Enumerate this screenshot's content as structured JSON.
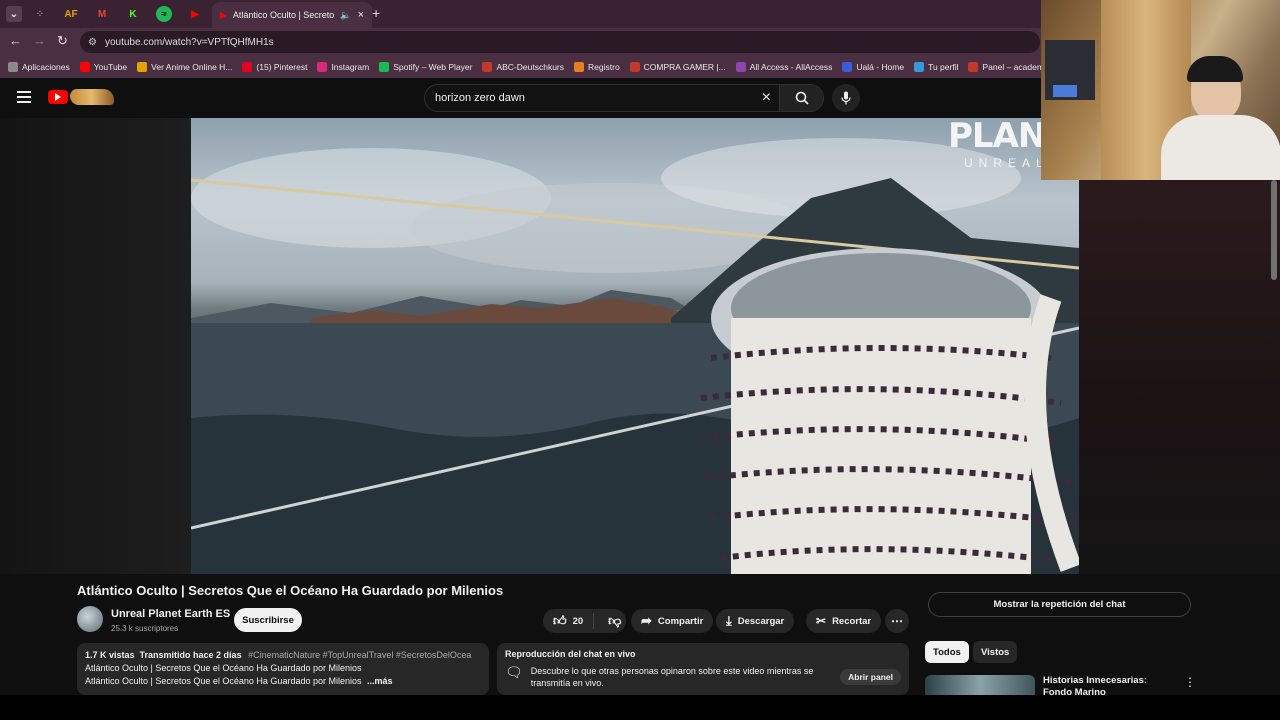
{
  "browser": {
    "active_tab_title": "Atlántico Oculto | Secretos",
    "new_tab": "+",
    "url": "youtube.com/watch?v=VPTfQHfMH1s"
  },
  "bookmarks": [
    {
      "label": "Aplicaciones",
      "color": "#8a8a8a"
    },
    {
      "label": "YouTube",
      "color": "#ff0000"
    },
    {
      "label": "Ver Anime Online H...",
      "color": "#e6a000"
    },
    {
      "label": "(15) Pinterest",
      "color": "#e60023"
    },
    {
      "label": "Instagram",
      "color": "#d62976"
    },
    {
      "label": "Spotify – Web Player",
      "color": "#1db954"
    },
    {
      "label": "ABC-Deutschkurs",
      "color": "#c0392b"
    },
    {
      "label": "Registro",
      "color": "#e67e22"
    },
    {
      "label": "COMPRA GAMER |...",
      "color": "#c0392b"
    },
    {
      "label": "All Access - AllAccess",
      "color": "#8e44ad"
    },
    {
      "label": "Ualá - Home",
      "color": "#3b5bdb"
    },
    {
      "label": "Tu perfil",
      "color": "#3498db"
    },
    {
      "label": "Panel – academia",
      "color": "#c0392b"
    }
  ],
  "yt": {
    "search_value": "horizon zero dawn"
  },
  "video": {
    "watermark_main": "PLANET",
    "watermark_sub": "UNREAL",
    "title": "Atlántico Oculto | Secretos Que el Océano Ha Guardado por Milenios"
  },
  "channel": {
    "name": "Unreal Planet Earth ES",
    "subs": "25.3 k suscriptores",
    "subscribe": "Suscribirse"
  },
  "actions": {
    "likes": "20",
    "share": "Compartir",
    "download": "Descargar",
    "clip": "Recortar"
  },
  "description": {
    "stats": "1.7 K vistas  Transmitido hace 2 días",
    "tags": "#CinematicNature #TopUnrealTravel #SecretosDelOcea",
    "line1": "Atlántico Oculto | Secretos Que el Océano Ha Guardado por Milenios",
    "line2": "Atlántico Oculto | Secretos Que el Océano Ha Guardado por Milenios",
    "more": "...más"
  },
  "chat": {
    "heading": "Reproducción del chat en vivo",
    "text": "Descubre lo que otras personas opinaron sobre este video mientras se transmitía en vivo.",
    "open": "Abrir panel"
  },
  "sidebar": {
    "show_chat": "Mostrar la repetición del chat",
    "chips": [
      "Todos",
      "Vistos"
    ],
    "next_video_title": "Historias Innecesarias: Fondo Marino"
  }
}
